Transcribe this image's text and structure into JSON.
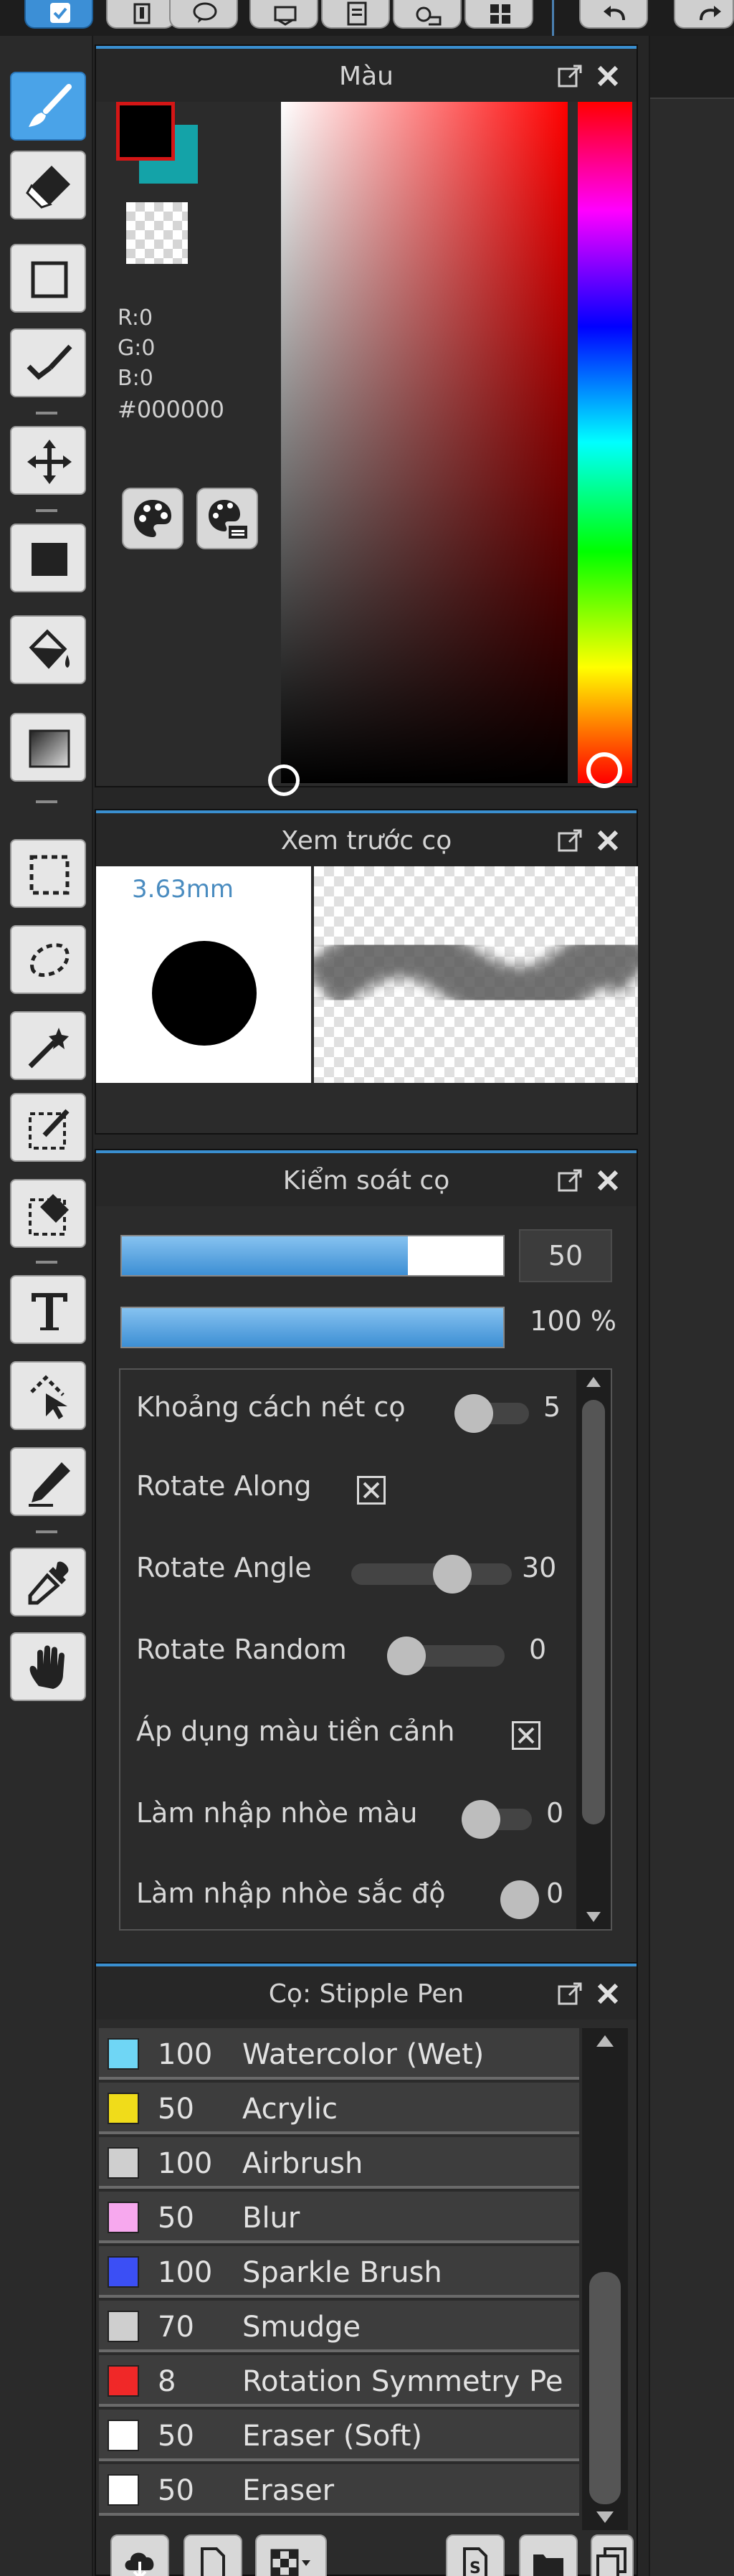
{
  "colors": {
    "accent": "#3a8fd0",
    "foreground_swatch": "#000000",
    "background_swatch": "#14a3a8"
  },
  "color_panel": {
    "title": "Màu",
    "r": "R:0",
    "g": "G:0",
    "b": "B:0",
    "hex": "#000000"
  },
  "brush_preview": {
    "title": "Xem trước cọ",
    "size": "3.63mm"
  },
  "brush_control": {
    "title": "Kiểm soát cọ",
    "size_value": "50",
    "size_fraction": 0.75,
    "opacity_value": "100 %",
    "opacity_fraction": 1.0,
    "settings": {
      "spacing": {
        "label": "Khoảng cách nét cọ",
        "value": "5"
      },
      "rotate_along": {
        "label": "Rotate Along",
        "checked": true
      },
      "rotate_angle": {
        "label": "Rotate Angle",
        "value": "30"
      },
      "rotate_random": {
        "label": "Rotate Random",
        "value": "0"
      },
      "apply_fg": {
        "label": "Áp dụng màu tiền cảnh",
        "checked": true
      },
      "blend_color": {
        "label": "Làm nhập nhòe màu",
        "value": "0"
      },
      "blend_hue": {
        "label": "Làm nhập nhòe sắc độ",
        "value": "0"
      }
    }
  },
  "brush_list": {
    "title": "Cọ: Stipple Pen",
    "items": [
      {
        "color": "#6fd6f5",
        "size": "100",
        "name": "Watercolor (Wet)"
      },
      {
        "color": "#f0dc1a",
        "size": "50",
        "name": "Acrylic"
      },
      {
        "color": "#cfcfcf",
        "size": "100",
        "name": "Airbrush"
      },
      {
        "color": "#f7a8ee",
        "size": "50",
        "name": "Blur"
      },
      {
        "color": "#3b4ff5",
        "size": "100",
        "name": "Sparkle Brush"
      },
      {
        "color": "#cfcfcf",
        "size": "70",
        "name": "Smudge"
      },
      {
        "color": "#f02828",
        "size": "8",
        "name": "Rotation Symmetry Pe"
      },
      {
        "color": "#ffffff",
        "size": "50",
        "name": "Eraser (Soft)"
      },
      {
        "color": "#ffffff",
        "size": "50",
        "name": "Eraser"
      }
    ]
  },
  "tools": [
    {
      "name": "brush-tool-icon",
      "active": true
    },
    {
      "name": "eraser-tool-icon"
    },
    {
      "name": "rectangle-tool-icon"
    },
    {
      "name": "check-brush-icon"
    },
    {
      "name": "move-tool-icon"
    },
    {
      "name": "fill-rect-icon"
    },
    {
      "name": "bucket-fill-icon"
    },
    {
      "name": "gradient-tool-icon"
    },
    {
      "name": "rect-select-icon"
    },
    {
      "name": "lasso-select-icon"
    },
    {
      "name": "magic-wand-icon"
    },
    {
      "name": "select-pen-icon"
    },
    {
      "name": "select-eraser-icon"
    },
    {
      "name": "text-tool-icon"
    },
    {
      "name": "operation-tool-icon"
    },
    {
      "name": "divide-tool-icon"
    },
    {
      "name": "eyedropper-icon"
    },
    {
      "name": "hand-tool-icon"
    }
  ]
}
